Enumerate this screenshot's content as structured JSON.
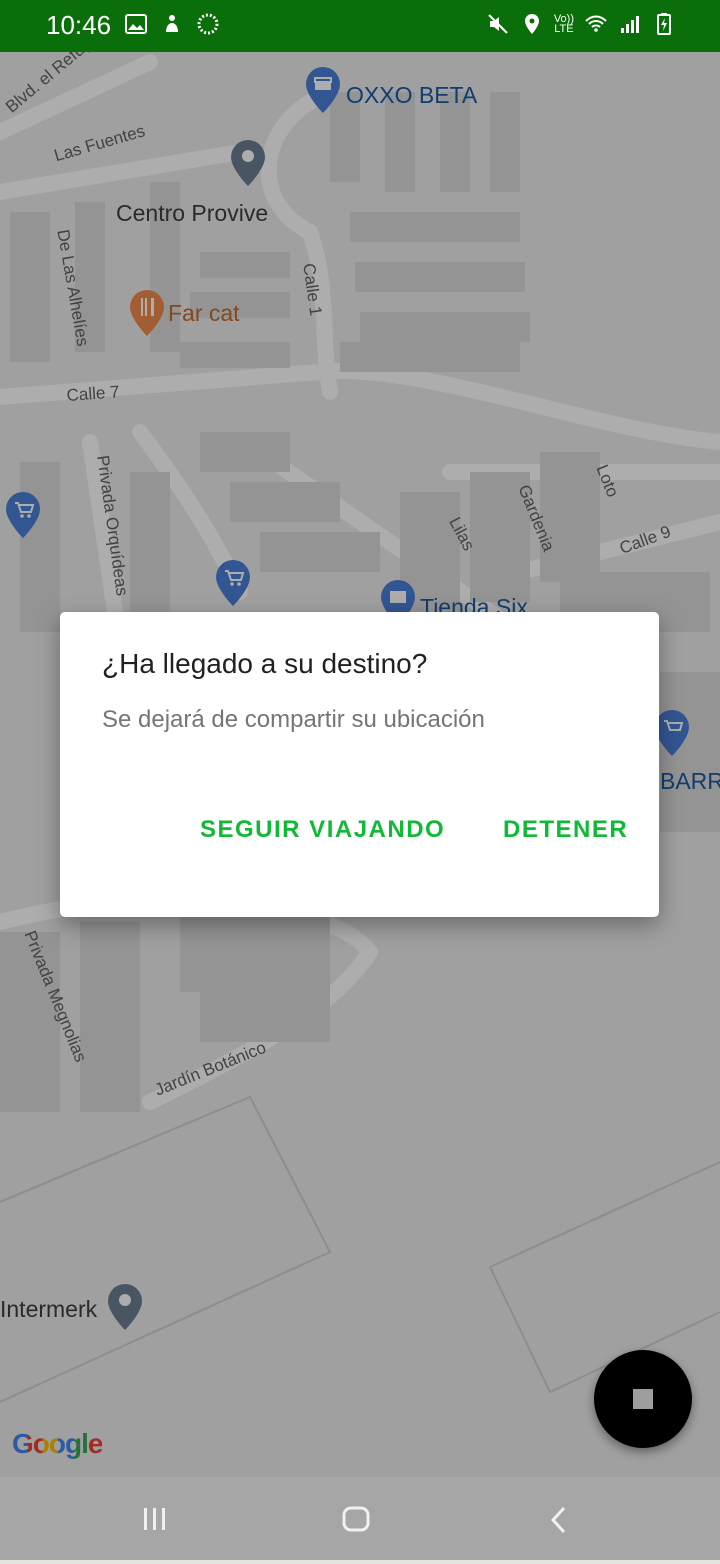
{
  "status_bar": {
    "time": "10:46",
    "left_icons": [
      "image-icon",
      "notification-icon",
      "sync-icon"
    ],
    "right_icons": [
      "mute-icon",
      "location-icon",
      "volte-icon",
      "wifi-icon",
      "signal-icon",
      "battery-charging-icon"
    ],
    "volte_label_top": "Vo))",
    "volte_label_bottom": "LTE",
    "background_color": "#0a6e0a"
  },
  "map": {
    "street_labels": {
      "refugio": "Blvd. el Refugio",
      "fuentes": "Las Fuentes",
      "alhelies": "De Las Alhelíes",
      "calle1": "Calle 1",
      "calle7": "Calle 7",
      "orquideas": "Privada Orquídeas",
      "lilas": "Lilas",
      "gardenia": "Gardenia",
      "loto": "Loto",
      "calle9": "Calle 9",
      "magnolias": "Privada Megnolias",
      "botanico": "Jardín Botánico"
    },
    "pois": {
      "oxxo": "OXXO BETA",
      "centro": "Centro Provive",
      "farcat": "Far cat",
      "tienda": "Tienda Six",
      "barr": "BARR",
      "intermerk": "Intermerk"
    },
    "attribution": "Google"
  },
  "dialog": {
    "title": "¿Ha llegado a su destino?",
    "message": "Se dejará de compartir su ubicación",
    "continue_label": "SEGUIR VIAJANDO",
    "stop_label": "DETENER",
    "accent_color": "#12b837"
  },
  "fab": {
    "icon": "stop-icon"
  },
  "nav_bar": {
    "buttons": [
      "recent-apps-icon",
      "home-icon",
      "back-icon"
    ]
  }
}
